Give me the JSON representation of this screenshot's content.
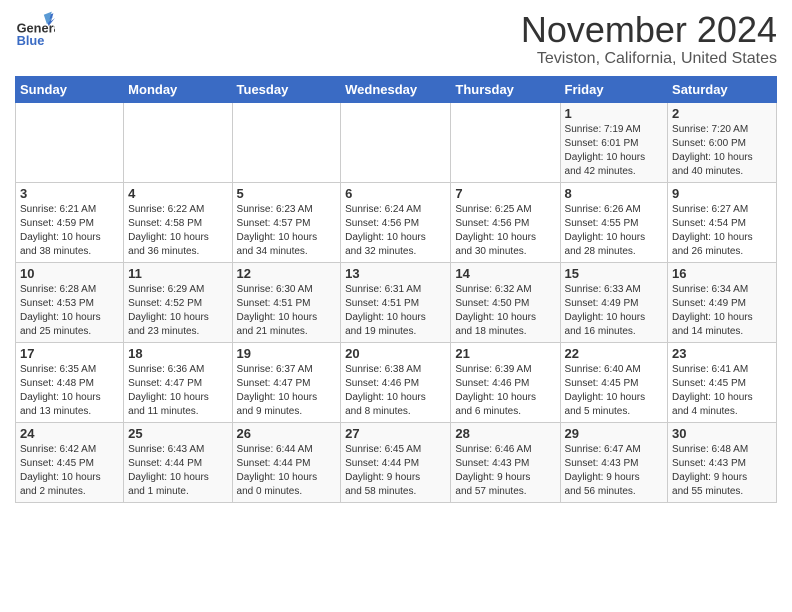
{
  "header": {
    "logo_general": "General",
    "logo_blue": "Blue",
    "month_title": "November 2024",
    "location": "Teviston, California, United States"
  },
  "weekdays": [
    "Sunday",
    "Monday",
    "Tuesday",
    "Wednesday",
    "Thursday",
    "Friday",
    "Saturday"
  ],
  "weeks": [
    [
      {
        "day": "",
        "info": ""
      },
      {
        "day": "",
        "info": ""
      },
      {
        "day": "",
        "info": ""
      },
      {
        "day": "",
        "info": ""
      },
      {
        "day": "",
        "info": ""
      },
      {
        "day": "1",
        "info": "Sunrise: 7:19 AM\nSunset: 6:01 PM\nDaylight: 10 hours\nand 42 minutes."
      },
      {
        "day": "2",
        "info": "Sunrise: 7:20 AM\nSunset: 6:00 PM\nDaylight: 10 hours\nand 40 minutes."
      }
    ],
    [
      {
        "day": "3",
        "info": "Sunrise: 6:21 AM\nSunset: 4:59 PM\nDaylight: 10 hours\nand 38 minutes."
      },
      {
        "day": "4",
        "info": "Sunrise: 6:22 AM\nSunset: 4:58 PM\nDaylight: 10 hours\nand 36 minutes."
      },
      {
        "day": "5",
        "info": "Sunrise: 6:23 AM\nSunset: 4:57 PM\nDaylight: 10 hours\nand 34 minutes."
      },
      {
        "day": "6",
        "info": "Sunrise: 6:24 AM\nSunset: 4:56 PM\nDaylight: 10 hours\nand 32 minutes."
      },
      {
        "day": "7",
        "info": "Sunrise: 6:25 AM\nSunset: 4:56 PM\nDaylight: 10 hours\nand 30 minutes."
      },
      {
        "day": "8",
        "info": "Sunrise: 6:26 AM\nSunset: 4:55 PM\nDaylight: 10 hours\nand 28 minutes."
      },
      {
        "day": "9",
        "info": "Sunrise: 6:27 AM\nSunset: 4:54 PM\nDaylight: 10 hours\nand 26 minutes."
      }
    ],
    [
      {
        "day": "10",
        "info": "Sunrise: 6:28 AM\nSunset: 4:53 PM\nDaylight: 10 hours\nand 25 minutes."
      },
      {
        "day": "11",
        "info": "Sunrise: 6:29 AM\nSunset: 4:52 PM\nDaylight: 10 hours\nand 23 minutes."
      },
      {
        "day": "12",
        "info": "Sunrise: 6:30 AM\nSunset: 4:51 PM\nDaylight: 10 hours\nand 21 minutes."
      },
      {
        "day": "13",
        "info": "Sunrise: 6:31 AM\nSunset: 4:51 PM\nDaylight: 10 hours\nand 19 minutes."
      },
      {
        "day": "14",
        "info": "Sunrise: 6:32 AM\nSunset: 4:50 PM\nDaylight: 10 hours\nand 18 minutes."
      },
      {
        "day": "15",
        "info": "Sunrise: 6:33 AM\nSunset: 4:49 PM\nDaylight: 10 hours\nand 16 minutes."
      },
      {
        "day": "16",
        "info": "Sunrise: 6:34 AM\nSunset: 4:49 PM\nDaylight: 10 hours\nand 14 minutes."
      }
    ],
    [
      {
        "day": "17",
        "info": "Sunrise: 6:35 AM\nSunset: 4:48 PM\nDaylight: 10 hours\nand 13 minutes."
      },
      {
        "day": "18",
        "info": "Sunrise: 6:36 AM\nSunset: 4:47 PM\nDaylight: 10 hours\nand 11 minutes."
      },
      {
        "day": "19",
        "info": "Sunrise: 6:37 AM\nSunset: 4:47 PM\nDaylight: 10 hours\nand 9 minutes."
      },
      {
        "day": "20",
        "info": "Sunrise: 6:38 AM\nSunset: 4:46 PM\nDaylight: 10 hours\nand 8 minutes."
      },
      {
        "day": "21",
        "info": "Sunrise: 6:39 AM\nSunset: 4:46 PM\nDaylight: 10 hours\nand 6 minutes."
      },
      {
        "day": "22",
        "info": "Sunrise: 6:40 AM\nSunset: 4:45 PM\nDaylight: 10 hours\nand 5 minutes."
      },
      {
        "day": "23",
        "info": "Sunrise: 6:41 AM\nSunset: 4:45 PM\nDaylight: 10 hours\nand 4 minutes."
      }
    ],
    [
      {
        "day": "24",
        "info": "Sunrise: 6:42 AM\nSunset: 4:45 PM\nDaylight: 10 hours\nand 2 minutes."
      },
      {
        "day": "25",
        "info": "Sunrise: 6:43 AM\nSunset: 4:44 PM\nDaylight: 10 hours\nand 1 minute."
      },
      {
        "day": "26",
        "info": "Sunrise: 6:44 AM\nSunset: 4:44 PM\nDaylight: 10 hours\nand 0 minutes."
      },
      {
        "day": "27",
        "info": "Sunrise: 6:45 AM\nSunset: 4:44 PM\nDaylight: 9 hours\nand 58 minutes."
      },
      {
        "day": "28",
        "info": "Sunrise: 6:46 AM\nSunset: 4:43 PM\nDaylight: 9 hours\nand 57 minutes."
      },
      {
        "day": "29",
        "info": "Sunrise: 6:47 AM\nSunset: 4:43 PM\nDaylight: 9 hours\nand 56 minutes."
      },
      {
        "day": "30",
        "info": "Sunrise: 6:48 AM\nSunset: 4:43 PM\nDaylight: 9 hours\nand 55 minutes."
      }
    ]
  ]
}
